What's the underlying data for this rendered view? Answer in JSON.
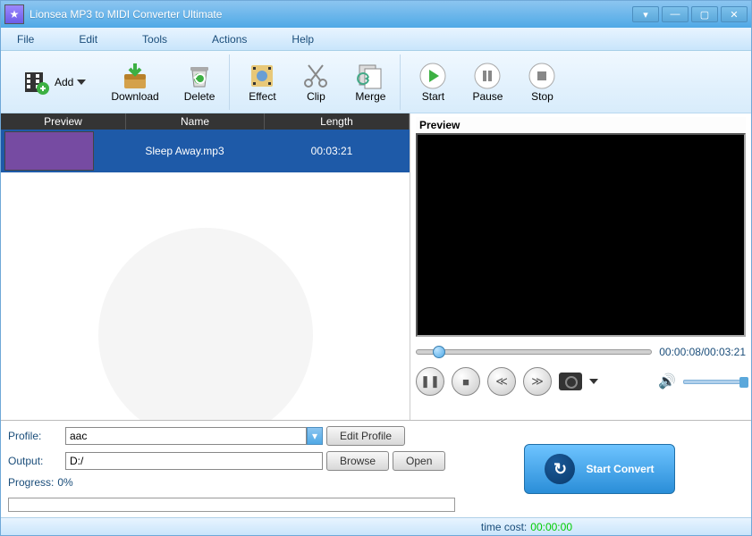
{
  "window": {
    "title": "Lionsea MP3 to MIDI Converter Ultimate"
  },
  "menu": {
    "file": "File",
    "edit": "Edit",
    "tools": "Tools",
    "actions": "Actions",
    "help": "Help"
  },
  "toolbar": {
    "add": "Add",
    "download": "Download",
    "delete": "Delete",
    "effect": "Effect",
    "clip": "Clip",
    "merge": "Merge",
    "start": "Start",
    "pause": "Pause",
    "stop": "Stop"
  },
  "list": {
    "headers": {
      "preview": "Preview",
      "name": "Name",
      "length": "Length"
    },
    "rows": [
      {
        "name": "Sleep Away.mp3",
        "length": "00:03:21"
      }
    ]
  },
  "preview": {
    "label": "Preview",
    "time": "00:00:08/00:03:21"
  },
  "form": {
    "profile_label": "Profile:",
    "profile_value": "aac",
    "edit_profile": "Edit Profile",
    "output_label": "Output:",
    "output_value": "D:/",
    "browse": "Browse",
    "open": "Open",
    "progress_label": "Progress:",
    "progress_value": "0%"
  },
  "convert": {
    "label": "Start Convert"
  },
  "status": {
    "label": "time cost:",
    "value": "00:00:00"
  }
}
